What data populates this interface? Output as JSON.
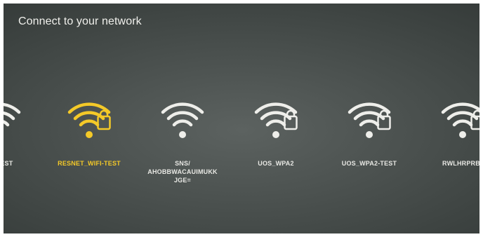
{
  "title": "Connect to your network",
  "colors": {
    "selected": "#f4c928",
    "normal": "#eeeeea"
  },
  "networks": [
    {
      "label": "FI-TEST",
      "secured": false,
      "selected": false
    },
    {
      "label": "RESNET_WIFI-TEST",
      "secured": true,
      "selected": true
    },
    {
      "label": "SNS/\nAHOBBWACAUIMUKK\nJGE=",
      "secured": false,
      "selected": false
    },
    {
      "label": "UOS_WPA2",
      "secured": true,
      "selected": false
    },
    {
      "label": "UOS_WPA2-TEST",
      "secured": true,
      "selected": false
    },
    {
      "label": "RWLHRPRB",
      "secured": true,
      "selected": false
    }
  ]
}
